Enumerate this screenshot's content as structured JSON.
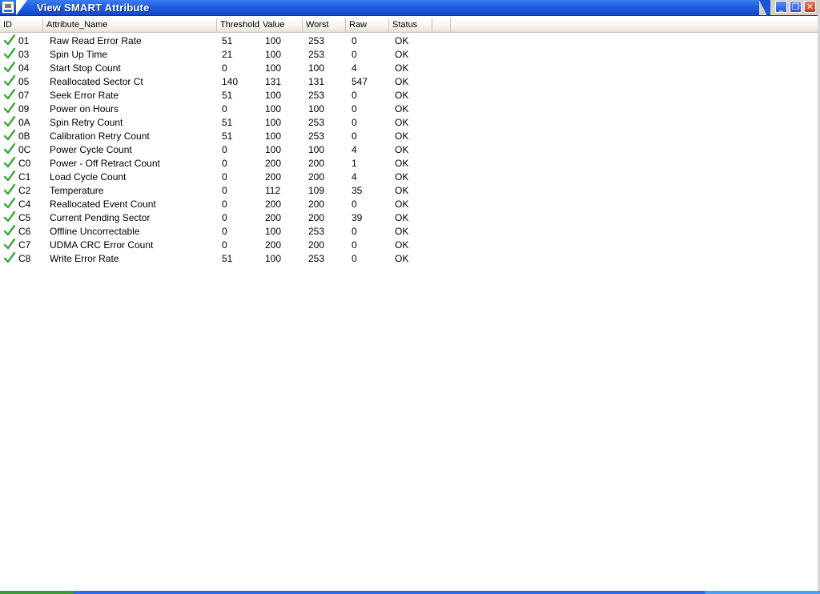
{
  "window": {
    "title": "View SMART Attribute"
  },
  "columns": [
    "ID",
    "Attribute_Name",
    "Threshold",
    "Value",
    "Worst",
    "Raw",
    "Status"
  ],
  "rows": [
    {
      "id": "01",
      "name": "Raw Read Error Rate",
      "threshold": "51",
      "value": "100",
      "worst": "253",
      "raw": "0",
      "status": "OK"
    },
    {
      "id": "03",
      "name": "Spin Up Time",
      "threshold": "21",
      "value": "100",
      "worst": "253",
      "raw": "0",
      "status": "OK"
    },
    {
      "id": "04",
      "name": "Start Stop Count",
      "threshold": "0",
      "value": "100",
      "worst": "100",
      "raw": "4",
      "status": "OK"
    },
    {
      "id": "05",
      "name": "Reallocated Sector Ct",
      "threshold": "140",
      "value": "131",
      "worst": "131",
      "raw": "547",
      "status": "OK"
    },
    {
      "id": "07",
      "name": "Seek Error Rate",
      "threshold": "51",
      "value": "100",
      "worst": "253",
      "raw": "0",
      "status": "OK"
    },
    {
      "id": "09",
      "name": "Power on Hours",
      "threshold": "0",
      "value": "100",
      "worst": "100",
      "raw": "0",
      "status": "OK"
    },
    {
      "id": "0A",
      "name": "Spin Retry Count",
      "threshold": "51",
      "value": "100",
      "worst": "253",
      "raw": "0",
      "status": "OK"
    },
    {
      "id": "0B",
      "name": "Calibration Retry Count",
      "threshold": "51",
      "value": "100",
      "worst": "253",
      "raw": "0",
      "status": "OK"
    },
    {
      "id": "0C",
      "name": "Power Cycle Count",
      "threshold": "0",
      "value": "100",
      "worst": "100",
      "raw": "4",
      "status": "OK"
    },
    {
      "id": "C0",
      "name": "Power - Off Retract Count",
      "threshold": "0",
      "value": "200",
      "worst": "200",
      "raw": "1",
      "status": "OK"
    },
    {
      "id": "C1",
      "name": "Load Cycle Count",
      "threshold": "0",
      "value": "200",
      "worst": "200",
      "raw": "4",
      "status": "OK"
    },
    {
      "id": "C2",
      "name": "Temperature",
      "threshold": "0",
      "value": "112",
      "worst": "109",
      "raw": "35",
      "status": "OK"
    },
    {
      "id": "C4",
      "name": "Reallocated Event Count",
      "threshold": "0",
      "value": "200",
      "worst": "200",
      "raw": "0",
      "status": "OK"
    },
    {
      "id": "C5",
      "name": "Current Pending Sector",
      "threshold": "0",
      "value": "200",
      "worst": "200",
      "raw": "39",
      "status": "OK"
    },
    {
      "id": "C6",
      "name": "Offline Uncorrectable",
      "threshold": "0",
      "value": "100",
      "worst": "253",
      "raw": "0",
      "status": "OK"
    },
    {
      "id": "C7",
      "name": "UDMA CRC Error Count",
      "threshold": "0",
      "value": "200",
      "worst": "200",
      "raw": "0",
      "status": "OK"
    },
    {
      "id": "C8",
      "name": "Write Error Rate",
      "threshold": "51",
      "value": "100",
      "worst": "253",
      "raw": "0",
      "status": "OK"
    }
  ],
  "icons": {
    "row_status": "check-icon",
    "app": "app-icon",
    "minimize": "minimize-icon",
    "restore": "restore-icon",
    "close": "close-icon"
  },
  "colors": {
    "check": "#3aa83a",
    "titlebar": "#1f5fe0"
  }
}
